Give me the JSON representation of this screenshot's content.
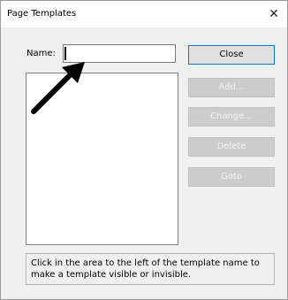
{
  "dialog": {
    "title": "Page Templates",
    "close_glyph": "✕"
  },
  "form": {
    "name_label": "Name:",
    "name_value": "",
    "name_placeholder": ""
  },
  "buttons": {
    "close": "Close",
    "add": "Add...",
    "change": "Change...",
    "delete": "Delete",
    "goto": "Goto"
  },
  "help_text": "Click in the area to the left of the template name to make a template visible or invisible.",
  "icons": {
    "close": "close-icon",
    "arrow": "arrow-pointer-icon"
  },
  "colors": {
    "dialog_bg": "#f0f0f0",
    "titlebar_bg": "#ffffff",
    "button_bg": "#e1e1e1",
    "disabled_button_bg": "#cccccc",
    "focus_border": "#0078d7"
  }
}
